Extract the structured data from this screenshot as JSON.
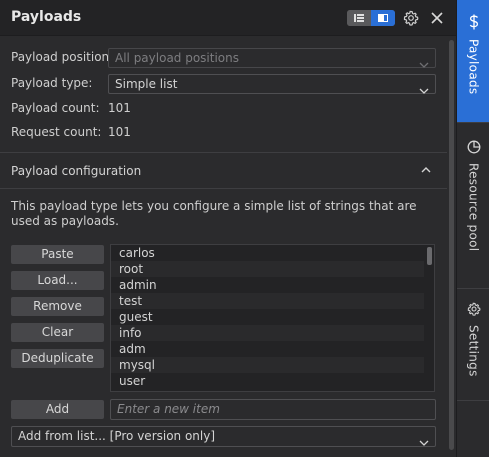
{
  "panel": {
    "title": "Payloads"
  },
  "fields": {
    "position_label": "Payload position:",
    "position_value": "All payload positions",
    "type_label": "Payload type:",
    "type_value": "Simple list",
    "count_label": "Payload count:",
    "count_value": "101",
    "request_label": "Request count:",
    "request_value": "101"
  },
  "config": {
    "title": "Payload configuration",
    "description": "This payload type lets you configure a simple list of strings that are used as payloads."
  },
  "buttons": {
    "paste": "Paste",
    "load": "Load...",
    "remove": "Remove",
    "clear": "Clear",
    "deduplicate": "Deduplicate",
    "add": "Add"
  },
  "list": {
    "items": [
      "carlos",
      "root",
      "admin",
      "test",
      "guest",
      "info",
      "adm",
      "mysql",
      "user"
    ]
  },
  "new_item": {
    "placeholder": "Enter a new item"
  },
  "add_from_list": {
    "value": "Add from list... [Pro version only]"
  },
  "sidebar": {
    "tabs": [
      {
        "label": "Payloads",
        "icon": "dollar-icon",
        "active": true
      },
      {
        "label": "Resource pool",
        "icon": "pie-chart-icon",
        "active": false
      },
      {
        "label": "Settings",
        "icon": "gear-icon",
        "active": false
      }
    ]
  },
  "colors": {
    "accent": "#2a6fd6",
    "background": "#2b2b2d",
    "button": "#47474a"
  }
}
